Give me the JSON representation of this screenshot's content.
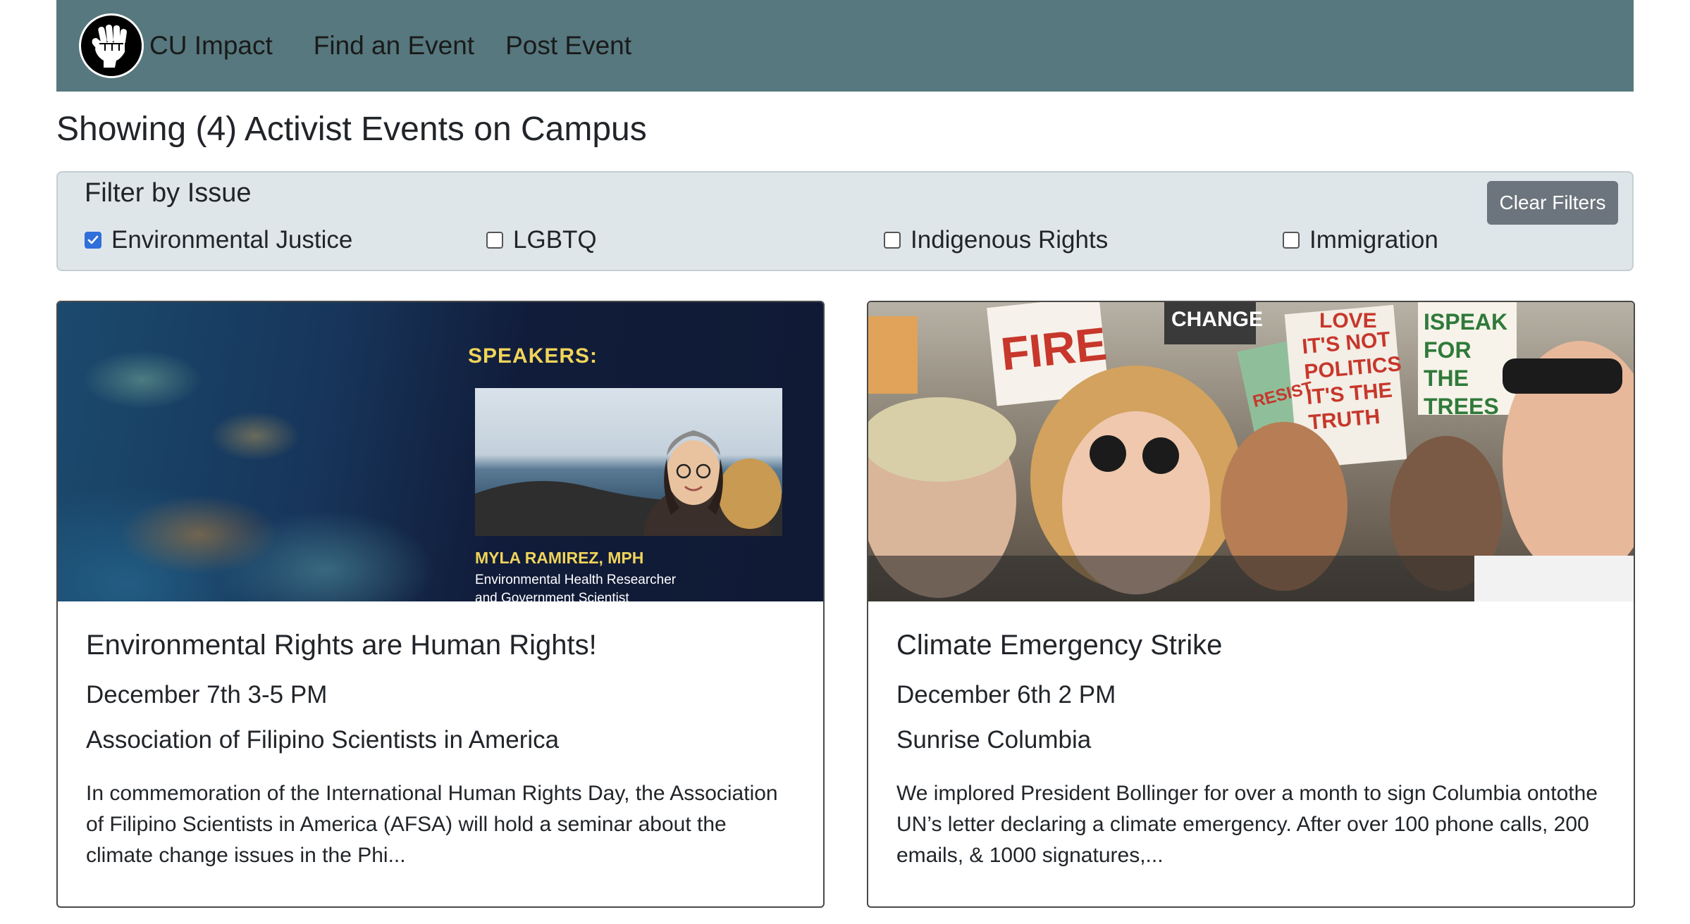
{
  "nav": {
    "brand": "CU Impact",
    "links": [
      "Find an Event",
      "Post Event"
    ]
  },
  "page": {
    "title": "Showing (4) Activist Events on Campus"
  },
  "filters": {
    "heading": "Filter by Issue",
    "clear_label": "Clear Filters",
    "options": [
      {
        "label": "Environmental Justice",
        "checked": true
      },
      {
        "label": "LGBTQ",
        "checked": false
      },
      {
        "label": "Indigenous Rights",
        "checked": false
      },
      {
        "label": "Immigration",
        "checked": false
      }
    ]
  },
  "events": [
    {
      "title": "Environmental Rights are Human Rights!",
      "date": "December 7th 3-5 PM",
      "org": "Association of Filipino Scientists in America",
      "description": "In commemoration of the International Human Rights Day, the Association of Filipino Scientists in America (AFSA) will hold a seminar about the climate change issues in the Phi...",
      "image": {
        "heading": "SPEAKERS:",
        "speaker_name": "MYLA RAMIREZ, MPH",
        "speaker_role_1": "Environmental Health Researcher",
        "speaker_role_2": "and Government Scientist"
      }
    },
    {
      "title": "Climate Emergency Strike",
      "date": "December 6th 2 PM",
      "org": "Sunrise Columbia",
      "description": "We implored President Bollinger for over a month to sign Columbia ontothe UN’s letter declaring a climate emergency. After over 100 phone calls, 200 emails, & 1000 signatures,...",
      "image": {
        "sign_1": "FIRE",
        "sign_2": "LOVE",
        "sign_3": "ISPEAK FOR THE TREES",
        "sign_4": "IT'S NOT POLITICS IT'S THE TRUTH",
        "sign_5": "RESIST",
        "sign_6": "CHANGE"
      }
    }
  ],
  "colors": {
    "navbar": "#56787e",
    "filter_bg": "#dfe6ea",
    "clear_button": "#6c757d",
    "checkbox_checked": "#2f6fdb",
    "speaker_text": "#f0d45a"
  }
}
